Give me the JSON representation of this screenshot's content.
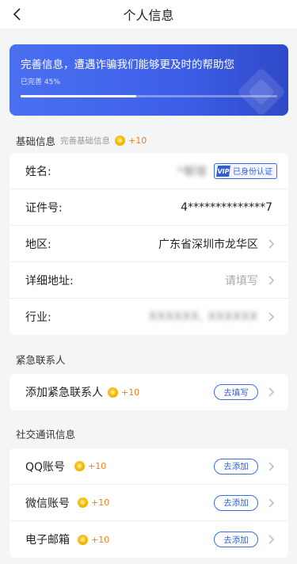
{
  "nav": {
    "title": "个人信息"
  },
  "banner": {
    "headline": "完善信息，遭遇诈骗我们能够更及时的帮助您",
    "progress_text": "已完善 45%",
    "progress": 0.45
  },
  "basic": {
    "title": "基础信息",
    "subtitle": "完善基础信息",
    "bonus": "+10",
    "rows": {
      "name": {
        "label": "姓名:",
        "value": "*郁瑄",
        "badge": "已身份认证",
        "badge_icon": "vip-icon"
      },
      "id": {
        "label": "证件号:",
        "value": "4**************7"
      },
      "region": {
        "label": "地区:",
        "value": "广东省深圳市龙华区"
      },
      "address": {
        "label": "详细地址:",
        "placeholder": "请填写"
      },
      "industry": {
        "label": "行业:",
        "value": "XXXXXX, XXXXXX"
      }
    }
  },
  "emergency": {
    "title": "紧急联系人",
    "row": {
      "label": "添加紧急联系人",
      "bonus": "+10",
      "action": "去填写"
    }
  },
  "social": {
    "title": "社交通讯信息",
    "rows": [
      {
        "label": "QQ账号",
        "bonus": "+10",
        "action": "去添加"
      },
      {
        "label": "微信账号",
        "bonus": "+10",
        "action": "去添加"
      },
      {
        "label": "电子邮箱",
        "bonus": "+10",
        "action": "去添加"
      }
    ]
  },
  "colors": {
    "accent": "#3b6ce6",
    "bonus": "#f07c1a",
    "coin": "#f6b400"
  }
}
